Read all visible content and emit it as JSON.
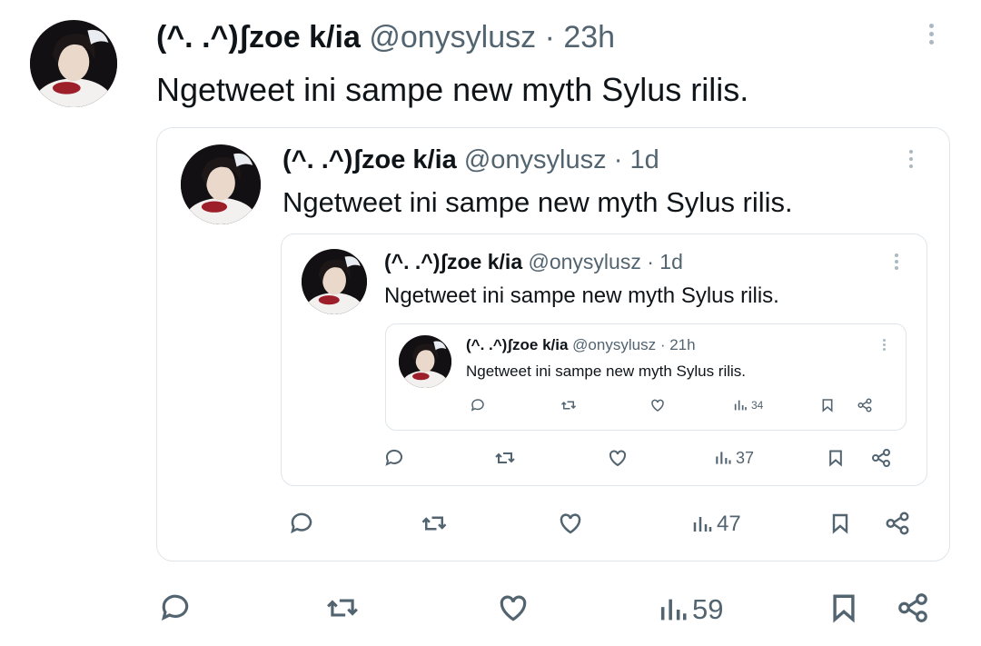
{
  "tweet": {
    "display_name": "(^. .^)ʃzoe k/ia",
    "handle": "@onysylusz",
    "separator": "·",
    "time": "23h",
    "text": "Ngetweet ini sampe new myth Sylus rilis.",
    "views": "59"
  },
  "quote1": {
    "display_name": "(^. .^)ʃzoe k/ia",
    "handle": "@onysylusz",
    "separator": "·",
    "time": "1d",
    "text": "Ngetweet ini sampe new myth Sylus rilis.",
    "views": "47"
  },
  "quote2": {
    "display_name": "(^. .^)ʃzoe k/ia",
    "handle": "@onysylusz",
    "separator": "·",
    "time": "1d",
    "text": "Ngetweet ini sampe new myth Sylus rilis.",
    "views": "37"
  },
  "quote3": {
    "display_name": "(^. .^)ʃzoe k/ia",
    "handle": "@onysylusz",
    "separator": "·",
    "time": "21h",
    "text": "Ngetweet ini sampe new myth Sylus rilis.",
    "views": "34"
  },
  "icons": [
    "reply-icon",
    "retweet-icon",
    "like-icon",
    "views-icon",
    "bookmark-icon",
    "share-icon",
    "more-icon"
  ],
  "colors": {
    "text": "#0f1419",
    "secondary": "#536471",
    "border": "#dfe5ea"
  }
}
